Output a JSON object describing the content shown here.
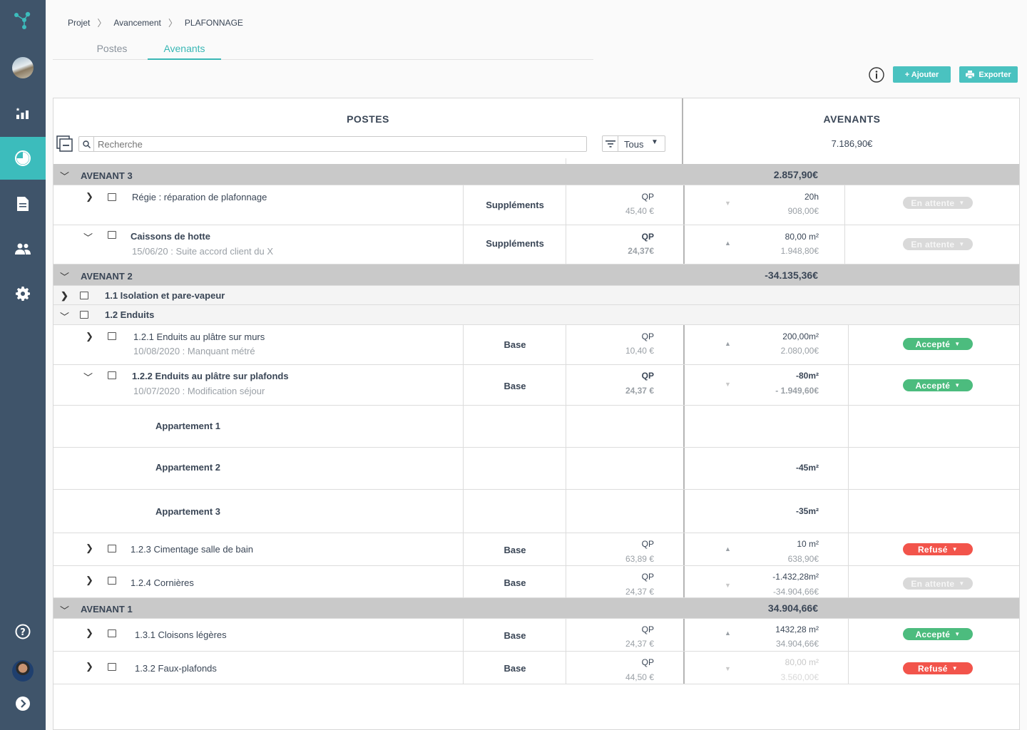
{
  "breadcrumb": {
    "items": [
      "Projet",
      "Avancement",
      "PLAFONNAGE"
    ]
  },
  "tabs": {
    "postes": "Postes",
    "avenants": "Avenants"
  },
  "toolbar": {
    "add_label": "+ Ajouter",
    "export_label": "Exporter"
  },
  "table": {
    "postes_header": "POSTES",
    "avenants_header": "AVENANTS",
    "avenants_total": "7.186,90€",
    "search_placeholder": "Recherche",
    "filter_value": "Tous"
  },
  "groups": {
    "a3": {
      "label": "AVENANT 3",
      "total": "2.857,90€"
    },
    "a2": {
      "label": "AVENANT 2",
      "total": "-34.135,36€"
    },
    "a1": {
      "label": "AVENANT 1",
      "total": "34.904,66€"
    }
  },
  "sections": {
    "s11": "1.1 Isolation et pare-vapeur",
    "s12": "1.2 Enduits"
  },
  "rows": {
    "regie": {
      "name": "Régie : réparation de plafonnage",
      "type": "Suppléments",
      "unit": "QP",
      "price": "45,40 €",
      "qty": "20h",
      "amount": "908,00€",
      "status": "En attente"
    },
    "caissons": {
      "name": "Caissons de hotte",
      "note": "15/06/20 : Suite accord client du X",
      "type": "Suppléments",
      "unit": "QP",
      "price": "24,37€",
      "qty": "80,00 m²",
      "amount": "1.948,80€",
      "status": "En attente"
    },
    "r121": {
      "name": "1.2.1 Enduits au plâtre sur murs",
      "note": "10/08/2020 : Manquant métré",
      "type": "Base",
      "unit": "QP",
      "price": "10,40 €",
      "qty": "200,00m²",
      "amount": "2.080,00€",
      "status": "Accepté"
    },
    "r122": {
      "name": "1.2.2 Enduits au plâtre sur plafonds",
      "note": "10/07/2020 : Modification séjour",
      "type": "Base",
      "unit": "QP",
      "price": "24,37 €",
      "qty": "-80m²",
      "amount": "- 1.949,60€",
      "status": "Accepté"
    },
    "app1": {
      "name": "Appartement 1",
      "qty": ""
    },
    "app2": {
      "name": "Appartement 2",
      "qty": "-45m²"
    },
    "app3": {
      "name": "Appartement 3",
      "qty": "-35m²"
    },
    "r123": {
      "name": "1.2.3 Cimentage salle de bain",
      "type": "Base",
      "unit": "QP",
      "price": "63,89 €",
      "qty": "10 m²",
      "amount": "638,90€",
      "status": "Refusé"
    },
    "r124": {
      "name": "1.2.4 Cornières",
      "type": "Base",
      "unit": "QP",
      "price": "24,37 €",
      "qty": "-1.432,28m²",
      "amount": "-34.904,66€",
      "status": "En attente"
    },
    "r131": {
      "name": "1.3.1 Cloisons légères",
      "type": "Base",
      "unit": "QP",
      "price": "24,37 €",
      "qty": "1432,28 m²",
      "amount": "34.904,66€",
      "status": "Accepté"
    },
    "r132": {
      "name": "1.3.2 Faux-plafonds",
      "type": "Base",
      "unit": "QP",
      "price": "44,50 €",
      "qty": "80,00 m²",
      "amount": "3.560,00€",
      "status": "Refusé"
    }
  },
  "colors": {
    "sidebar": "#3f546a",
    "accent": "#3cbcbc",
    "accepted": "#4cbc7e",
    "refused": "#f2544b",
    "pending": "#d9d9d9",
    "group_bg": "#c9c9c9"
  }
}
